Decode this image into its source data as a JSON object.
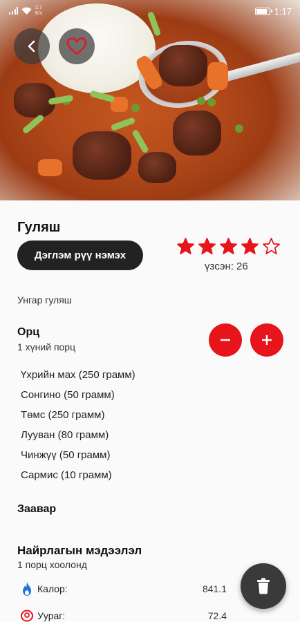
{
  "status_bar": {
    "net_speed": "2.7",
    "net_unit": "K/s",
    "time": "1:17"
  },
  "recipe": {
    "title": "Гуляш",
    "add_button_label": "Дэглэм рүү нэмэх",
    "rating": {
      "value": 4,
      "max": 5,
      "color": "#e8141c"
    },
    "views_label": "үзсэн:",
    "views_count": "26",
    "subtitle": "Унгар гуляш"
  },
  "portions": {
    "heading": "Орц",
    "label": "1 хүний порц"
  },
  "ingredients": [
    "Үхрийн мах (250 грамм)",
    "Сонгино (50 грамм)",
    "Төмс (250 грамм)",
    "Лууван (80 грамм)",
    "Чинжүү (50 грамм)",
    "Сармис (10 грамм)"
  ],
  "instructions": {
    "heading": "Заавар"
  },
  "nutrition": {
    "heading": "Найрлагын мэдээлэл",
    "subheading": "1 порц хоолонд",
    "rows": [
      {
        "label": "Калор:",
        "value": "841.1",
        "icon": "fire-icon"
      },
      {
        "label": "Уураг:",
        "value": "72.4",
        "icon": "protein-icon"
      }
    ]
  },
  "colors": {
    "accent": "#e8141c",
    "dark_button": "#222222",
    "fab": "#3a3a3a"
  }
}
